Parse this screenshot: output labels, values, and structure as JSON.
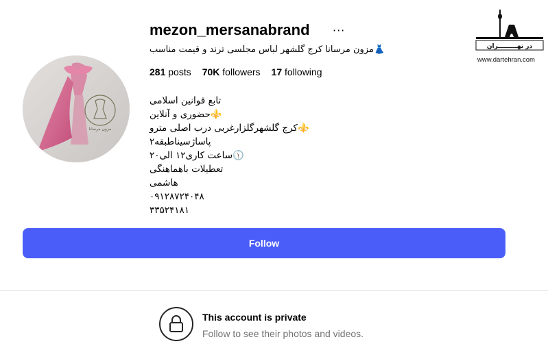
{
  "profile": {
    "username": "mezon_mersanabrand",
    "more_glyph": "···",
    "full_name": "مزون مرسانا کرج گلشهر لباس مجلسی ترند و قیمت مناسب",
    "full_name_emoji": "👗",
    "avatar_logo_text": "مزون مرسانا",
    "stats": {
      "posts_count": "281",
      "posts_label": "posts",
      "followers_count": "70K",
      "followers_label": "followers",
      "following_count": "17",
      "following_label": "following"
    },
    "bio": [
      "تابع قوانین اسلامی",
      "⚜️حضوری و آنلاین",
      "⚜️کرج گلشهرگلزارغربی درب اصلی مترو",
      "پاساژسیناطبقه۲",
      "🕦ساعت کاری۱۲ الی۲۰",
      "تعطیلات باهماهنگی",
      "هاشمی",
      "۰۹۱۲۸۷۲۴۰۴۸",
      "۳۳۵۲۴۱۸۱"
    ]
  },
  "actions": {
    "follow_label": "Follow"
  },
  "private": {
    "title": "This account is private",
    "subtitle": "Follow to see their photos and videos."
  },
  "watermark": {
    "brand_text": "در تهـــــــــران",
    "url": "www.dartehran.com"
  },
  "colors": {
    "follow_button": "#4a5df9",
    "subtitle_gray": "#737373",
    "divider": "#dbdbdb"
  },
  "icons": [
    "more-icon",
    "dress-icon",
    "lock-icon"
  ]
}
